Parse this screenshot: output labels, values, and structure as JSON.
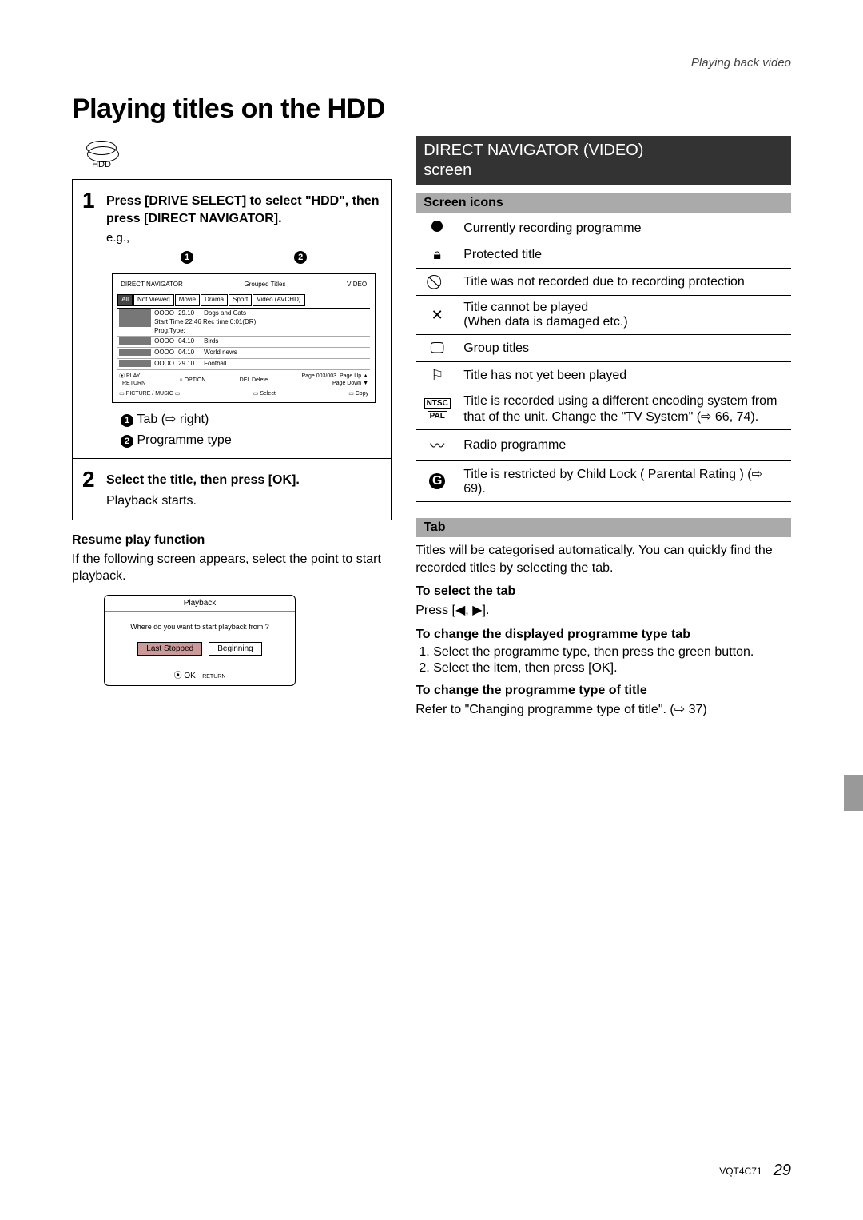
{
  "header_right": "Playing back video",
  "title": "Playing titles on the HDD",
  "hdd_label": "HDD",
  "step1": {
    "num": "1",
    "text_a": "Press [DRIVE SELECT] to select \"HDD\", then press [DIRECT NAVIGATOR].",
    "eg": "e.g.,",
    "callout1": "1",
    "callout2": "2",
    "dn": {
      "heading_left": "DIRECT NAVIGATOR",
      "heading_mid": "Grouped Titles",
      "heading_right": "VIDEO",
      "tabs": [
        "All",
        "Not Viewed",
        "Movie",
        "Drama",
        "Sport",
        "Video (AVCHD)"
      ],
      "rows": [
        {
          "ch": "OOOO",
          "date": "29.10",
          "title": "Dogs and Cats",
          "sub": "Start Time 22:46 Rec time 0:01(DR)",
          "extra": "Prog.Type:"
        },
        {
          "ch": "OOOO",
          "date": "04.10",
          "title": "Birds"
        },
        {
          "ch": "OOOO",
          "date": "04.10",
          "title": "World news"
        },
        {
          "ch": "OOOO",
          "date": "29.10",
          "title": "Football"
        }
      ],
      "page": "Page 003/003",
      "pageup": "Page Up",
      "pagedn": "Page Down",
      "foot_play": "PLAY",
      "foot_return": "RETURN",
      "foot_option": "OPTION",
      "foot_del": "DEL Delete",
      "foot_pic": "PICTURE / MUSIC",
      "foot_select": "Select",
      "foot_copy": "Copy"
    },
    "key1_num": "1",
    "key1_txt": "Tab (⇨ right)",
    "key2_num": "2",
    "key2_txt": "Programme type"
  },
  "step2": {
    "num": "2",
    "bold": "Select the title, then press [OK].",
    "after": "Playback starts."
  },
  "resume": {
    "head": "Resume play function",
    "para": "If the following screen appears, select the point to start playback.",
    "dlg_title": "Playback",
    "dlg_q": "Where do you want to start playback from ?",
    "btn_last": "Last Stopped",
    "btn_begin": "Beginning",
    "ok": "OK",
    "return": "RETURN"
  },
  "rcol": {
    "sec_title_1": "DIRECT NAVIGATOR (VIDEO)",
    "sec_title_2": "screen",
    "sub_icons": "Screen icons",
    "icons": [
      "Currently recording programme",
      "Protected title",
      "Title was not recorded due to recording protection",
      "Title cannot be played\n(When data is damaged etc.)",
      "Group titles",
      "Title has not yet been played",
      "Title is recorded using a different encoding system from that of the unit. Change the \"TV System\" (⇨ 66, 74).",
      "Radio programme",
      "Title is restricted by Child Lock ( Parental Rating ) (⇨ 69)."
    ],
    "ntsc": "NTSC",
    "pal": "PAL",
    "sub_tab": "Tab",
    "tab_para": "Titles will be categorised automatically. You can quickly find the recorded titles by selecting the tab.",
    "sub_select": "To select the tab",
    "select_body": "Press [◀, ▶].",
    "sub_change1": "To change the displayed programme type tab",
    "ch1_step1": "Select the programme type, then press the green button.",
    "ch1_step2": "Select the item, then press [OK].",
    "sub_change2": "To change the programme type of title",
    "ch2_body": "Refer to \"Changing programme type of title\". (⇨ 37)"
  },
  "footer_code": "VQT4C71",
  "footer_page": "29"
}
